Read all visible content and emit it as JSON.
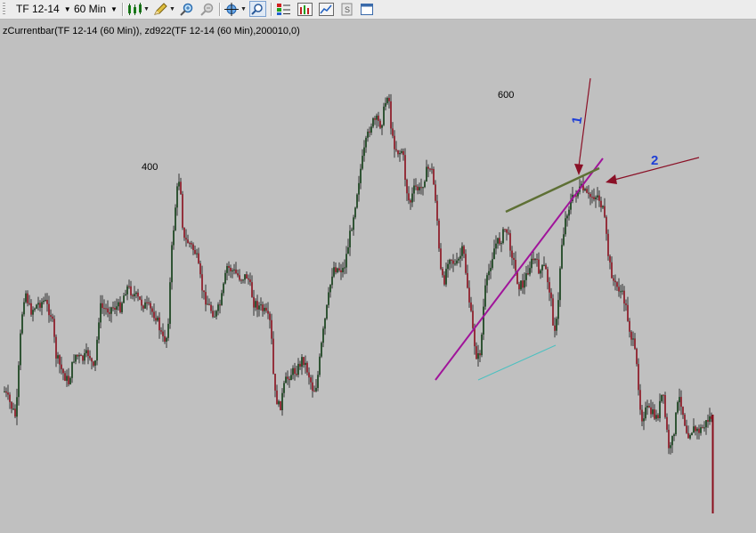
{
  "toolbar": {
    "symbol": "TF 12-14",
    "timeframe": "60 Min",
    "tools": [
      {
        "name": "candlestick-chart-icon"
      },
      {
        "name": "pencil-drawing-icon"
      },
      {
        "name": "zoom-in-icon"
      },
      {
        "name": "zoom-out-icon"
      },
      {
        "name": "crosshair-icon"
      },
      {
        "name": "magnify-tool-icon"
      },
      {
        "name": "indicator-list-icon"
      },
      {
        "name": "bar-chart-icon"
      },
      {
        "name": "line-chart-icon"
      },
      {
        "name": "strategy-icon"
      },
      {
        "name": "window-icon"
      }
    ]
  },
  "study_label": "zCurrentbar(TF 12-14 (60 Min)), zd922(TF 12-14 (60 Min),200010,0)",
  "chart": {
    "level_labels": [
      "400",
      "600"
    ],
    "annotations": [
      "1",
      "2"
    ],
    "colors": {
      "background": "#c0c0c0",
      "up_candle": "#0d3a12",
      "down_candle": "#8a0e1c",
      "wick": "#111111",
      "magenta_line": "#a0149a",
      "olive_line": "#5e7035",
      "teal_line": "#4cc0c0",
      "arrow": "#8a1026",
      "annotation_text": "#1f3fd6"
    }
  }
}
